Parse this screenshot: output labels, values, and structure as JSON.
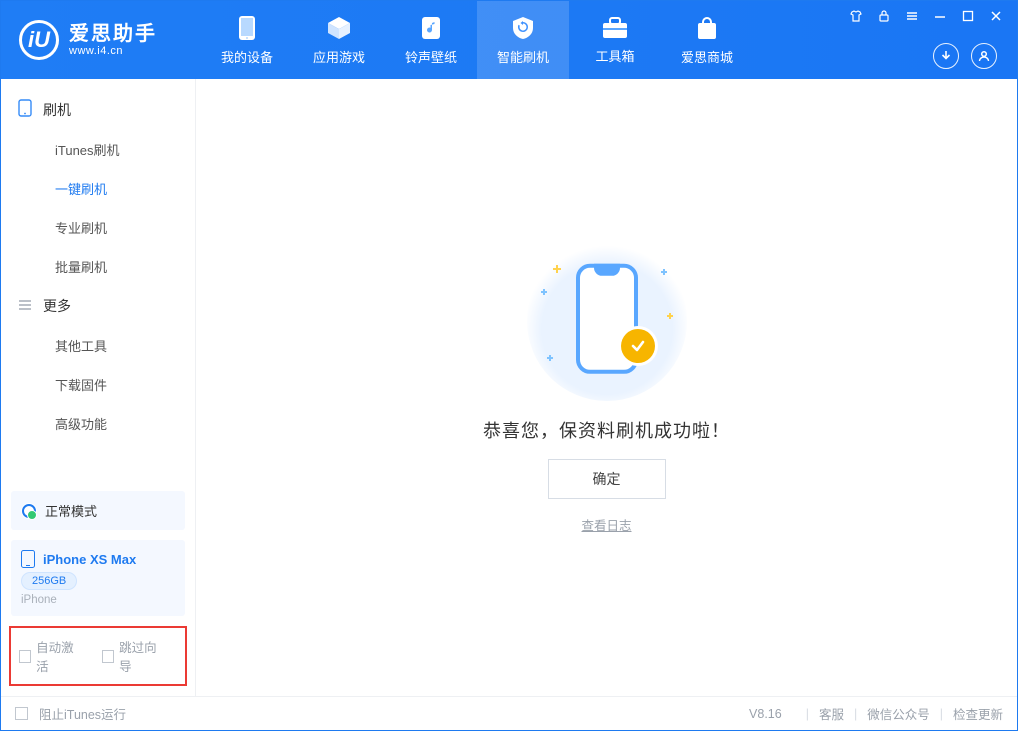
{
  "colors": {
    "brand": "#1e7af0",
    "accent": "#f7b500",
    "border": "#eef0f3",
    "danger": "#eb3a34"
  },
  "logo": {
    "cn": "爱思助手",
    "en": "www.i4.cn",
    "mark": "iU"
  },
  "nav": {
    "items": [
      {
        "id": "device",
        "label": "我的设备"
      },
      {
        "id": "apps",
        "label": "应用游戏"
      },
      {
        "id": "ring",
        "label": "铃声壁纸"
      },
      {
        "id": "flash",
        "label": "智能刷机"
      },
      {
        "id": "tools",
        "label": "工具箱"
      },
      {
        "id": "store",
        "label": "爱思商城"
      }
    ],
    "active": "flash"
  },
  "sidebar": {
    "flash_title": "刷机",
    "more_title": "更多",
    "flash_items": [
      {
        "id": "itunes",
        "label": "iTunes刷机"
      },
      {
        "id": "onekey",
        "label": "一键刷机"
      },
      {
        "id": "pro",
        "label": "专业刷机"
      },
      {
        "id": "batch",
        "label": "批量刷机"
      }
    ],
    "more_items": [
      {
        "id": "other",
        "label": "其他工具"
      },
      {
        "id": "firmware",
        "label": "下载固件"
      },
      {
        "id": "advanced",
        "label": "高级功能"
      }
    ],
    "active": "onekey",
    "device_mode": "正常模式",
    "device": {
      "name": "iPhone XS Max",
      "storage": "256GB",
      "type": "iPhone"
    },
    "options": {
      "auto_activate": "自动激活",
      "skip_guide": "跳过向导"
    }
  },
  "main": {
    "success": "恭喜您，保资料刷机成功啦！",
    "ok": "确定",
    "view_log": "查看日志"
  },
  "statusbar": {
    "block_itunes": "阻止iTunes运行",
    "version": "V8.16",
    "links": {
      "support": "客服",
      "wechat": "微信公众号",
      "update": "检查更新"
    }
  }
}
